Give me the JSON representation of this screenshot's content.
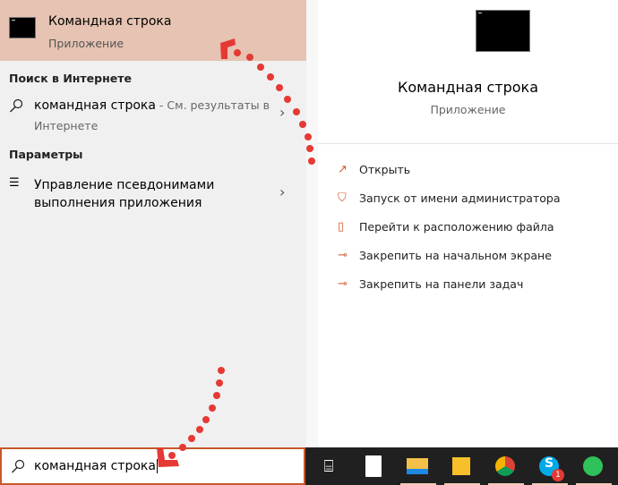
{
  "best_match": {
    "title": "Командная строка",
    "subtitle": "Приложение"
  },
  "web_section": {
    "header": "Поиск в Интернете",
    "query": "командная строка",
    "suffix": " - См. результаты в",
    "suffix2": "Интернете"
  },
  "settings_section": {
    "header": "Параметры",
    "item_line1": "Управление псевдонимами",
    "item_line2": "выполнения приложения"
  },
  "detail": {
    "title": "Командная строка",
    "subtitle": "Приложение",
    "actions": [
      {
        "label": "Открыть",
        "icon": "open-icon"
      },
      {
        "label": "Запуск от имени администратора",
        "icon": "shield-icon"
      },
      {
        "label": "Перейти к расположению файла",
        "icon": "file-location-icon"
      },
      {
        "label": "Закрепить на начальном экране",
        "icon": "pin-icon"
      },
      {
        "label": "Закрепить на панели задач",
        "icon": "pin-icon"
      }
    ]
  },
  "search": {
    "value": "командная строка"
  },
  "taskbar": {
    "skype_badge": "1"
  },
  "colors": {
    "accent": "#c8582a",
    "highlight": "#e6c3b2",
    "arrow": "#e53935",
    "taskbar": "#202020"
  }
}
